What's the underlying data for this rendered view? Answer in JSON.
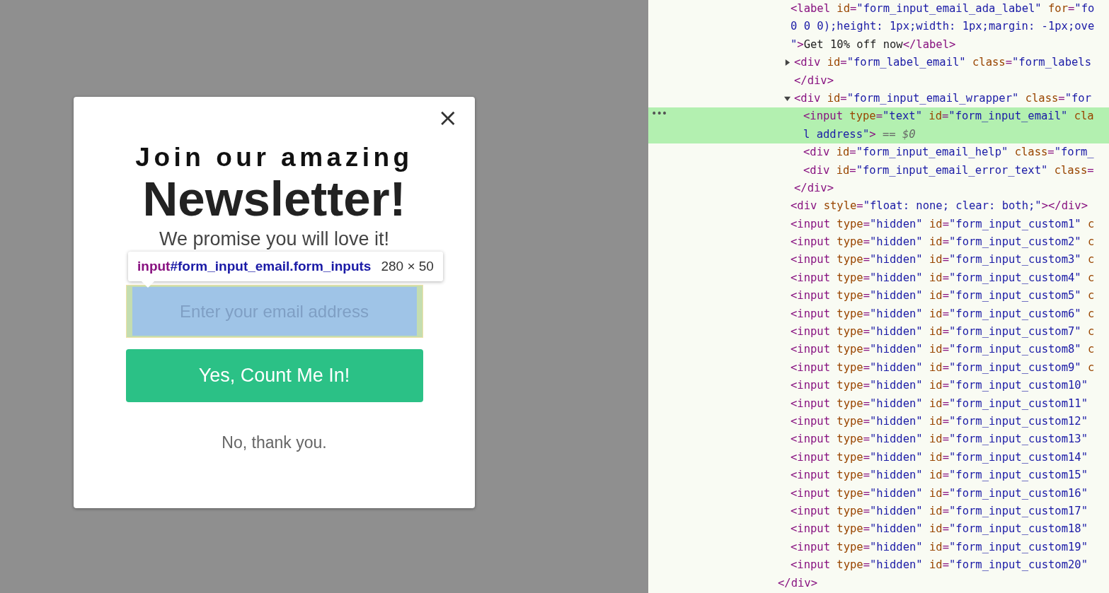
{
  "popup": {
    "close_label": "×",
    "title_line1": "Join our amazing",
    "title_line2": "Newsletter!",
    "subtitle": "We promise you will love it!",
    "email_field": {
      "placeholder": "Enter your email address",
      "inspected": true
    },
    "submit_button": "Yes, Count Me In!",
    "decline_link": "No, thank you."
  },
  "inspector_tooltip": {
    "tag": "input",
    "selector": "#form_input_email.form_inputs",
    "size": "280 × 50"
  },
  "elements_tree": {
    "row_menu": "•••",
    "closing": [
      {
        "kind": "tag",
        "text": "</div>"
      }
    ],
    "children": [
      {
        "selected": false,
        "lines": [
          [
            {
              "kind": "tag",
              "text": "<label"
            },
            {
              "kind": "attr",
              "text": " id"
            },
            {
              "kind": "tag",
              "text": "="
            },
            {
              "kind": "val",
              "text": "\"form_input_email_ada_label\""
            },
            {
              "kind": "attr",
              "text": " for"
            },
            {
              "kind": "tag",
              "text": "="
            },
            {
              "kind": "val",
              "text": "\"fo"
            }
          ],
          [
            {
              "kind": "val",
              "text": "0 0 0);height: 1px;width: 1px;margin: -1px;ove"
            }
          ],
          [
            {
              "kind": "val",
              "text": "\""
            },
            {
              "kind": "tag",
              "text": ">"
            },
            {
              "kind": "text",
              "text": "Get 10% off now"
            },
            {
              "kind": "tag",
              "text": "</label>"
            }
          ]
        ]
      },
      {
        "selected": false,
        "expanded": false,
        "lines": [
          [
            {
              "kind": "tag",
              "text": "<div"
            },
            {
              "kind": "attr",
              "text": " id"
            },
            {
              "kind": "tag",
              "text": "="
            },
            {
              "kind": "val",
              "text": "\"form_label_email\""
            },
            {
              "kind": "attr",
              "text": " class"
            },
            {
              "kind": "tag",
              "text": "="
            },
            {
              "kind": "val",
              "text": "\"form_labels"
            }
          ]
        ],
        "closing": [
          {
            "kind": "tag",
            "text": "</div>"
          }
        ]
      },
      {
        "selected": false,
        "expanded": true,
        "lines": [
          [
            {
              "kind": "tag",
              "text": "<div"
            },
            {
              "kind": "attr",
              "text": " id"
            },
            {
              "kind": "tag",
              "text": "="
            },
            {
              "kind": "val",
              "text": "\"form_input_email_wrapper\""
            },
            {
              "kind": "attr",
              "text": " class"
            },
            {
              "kind": "tag",
              "text": "="
            },
            {
              "kind": "val",
              "text": "\"for"
            }
          ]
        ],
        "closing": [
          {
            "kind": "tag",
            "text": "</div>"
          }
        ],
        "children": [
          {
            "selected": true,
            "lines": [
              [
                {
                  "kind": "tag",
                  "text": "<input"
                },
                {
                  "kind": "attr",
                  "text": " type"
                },
                {
                  "kind": "tag",
                  "text": "="
                },
                {
                  "kind": "val",
                  "text": "\"text\""
                },
                {
                  "kind": "attr",
                  "text": " id"
                },
                {
                  "kind": "tag",
                  "text": "="
                },
                {
                  "kind": "val",
                  "text": "\"form_input_email\""
                },
                {
                  "kind": "attr",
                  "text": " cla"
                }
              ],
              [
                {
                  "kind": "val",
                  "text": "l address\""
                },
                {
                  "kind": "tag",
                  "text": ">"
                },
                {
                  "kind": "dim",
                  "text": " == $0"
                }
              ]
            ]
          },
          {
            "selected": false,
            "lines": [
              [
                {
                  "kind": "tag",
                  "text": "<div"
                },
                {
                  "kind": "attr",
                  "text": " id"
                },
                {
                  "kind": "tag",
                  "text": "="
                },
                {
                  "kind": "val",
                  "text": "\"form_input_email_help\""
                },
                {
                  "kind": "attr",
                  "text": " class"
                },
                {
                  "kind": "tag",
                  "text": "="
                },
                {
                  "kind": "val",
                  "text": "\"form_"
                }
              ]
            ]
          },
          {
            "selected": false,
            "lines": [
              [
                {
                  "kind": "tag",
                  "text": "<div"
                },
                {
                  "kind": "attr",
                  "text": " id"
                },
                {
                  "kind": "tag",
                  "text": "="
                },
                {
                  "kind": "val",
                  "text": "\"form_input_email_error_text\""
                },
                {
                  "kind": "attr",
                  "text": " class"
                },
                {
                  "kind": "tag",
                  "text": "="
                }
              ]
            ]
          }
        ]
      },
      {
        "selected": false,
        "lines": [
          [
            {
              "kind": "tag",
              "text": "<div"
            },
            {
              "kind": "attr",
              "text": " style"
            },
            {
              "kind": "tag",
              "text": "="
            },
            {
              "kind": "val",
              "text": "\"float: none; clear: both;\""
            },
            {
              "kind": "tag",
              "text": "></div>"
            }
          ]
        ]
      },
      {
        "selected": false,
        "lines": [
          [
            {
              "kind": "tag",
              "text": "<input"
            },
            {
              "kind": "attr",
              "text": " type"
            },
            {
              "kind": "tag",
              "text": "="
            },
            {
              "kind": "val",
              "text": "\"hidden\""
            },
            {
              "kind": "attr",
              "text": " id"
            },
            {
              "kind": "tag",
              "text": "="
            },
            {
              "kind": "val",
              "text": "\"form_input_custom1\""
            },
            {
              "kind": "attr",
              "text": " c"
            }
          ]
        ]
      },
      {
        "selected": false,
        "lines": [
          [
            {
              "kind": "tag",
              "text": "<input"
            },
            {
              "kind": "attr",
              "text": " type"
            },
            {
              "kind": "tag",
              "text": "="
            },
            {
              "kind": "val",
              "text": "\"hidden\""
            },
            {
              "kind": "attr",
              "text": " id"
            },
            {
              "kind": "tag",
              "text": "="
            },
            {
              "kind": "val",
              "text": "\"form_input_custom2\""
            },
            {
              "kind": "attr",
              "text": " c"
            }
          ]
        ]
      },
      {
        "selected": false,
        "lines": [
          [
            {
              "kind": "tag",
              "text": "<input"
            },
            {
              "kind": "attr",
              "text": " type"
            },
            {
              "kind": "tag",
              "text": "="
            },
            {
              "kind": "val",
              "text": "\"hidden\""
            },
            {
              "kind": "attr",
              "text": " id"
            },
            {
              "kind": "tag",
              "text": "="
            },
            {
              "kind": "val",
              "text": "\"form_input_custom3\""
            },
            {
              "kind": "attr",
              "text": " c"
            }
          ]
        ]
      },
      {
        "selected": false,
        "lines": [
          [
            {
              "kind": "tag",
              "text": "<input"
            },
            {
              "kind": "attr",
              "text": " type"
            },
            {
              "kind": "tag",
              "text": "="
            },
            {
              "kind": "val",
              "text": "\"hidden\""
            },
            {
              "kind": "attr",
              "text": " id"
            },
            {
              "kind": "tag",
              "text": "="
            },
            {
              "kind": "val",
              "text": "\"form_input_custom4\""
            },
            {
              "kind": "attr",
              "text": " c"
            }
          ]
        ]
      },
      {
        "selected": false,
        "lines": [
          [
            {
              "kind": "tag",
              "text": "<input"
            },
            {
              "kind": "attr",
              "text": " type"
            },
            {
              "kind": "tag",
              "text": "="
            },
            {
              "kind": "val",
              "text": "\"hidden\""
            },
            {
              "kind": "attr",
              "text": " id"
            },
            {
              "kind": "tag",
              "text": "="
            },
            {
              "kind": "val",
              "text": "\"form_input_custom5\""
            },
            {
              "kind": "attr",
              "text": " c"
            }
          ]
        ]
      },
      {
        "selected": false,
        "lines": [
          [
            {
              "kind": "tag",
              "text": "<input"
            },
            {
              "kind": "attr",
              "text": " type"
            },
            {
              "kind": "tag",
              "text": "="
            },
            {
              "kind": "val",
              "text": "\"hidden\""
            },
            {
              "kind": "attr",
              "text": " id"
            },
            {
              "kind": "tag",
              "text": "="
            },
            {
              "kind": "val",
              "text": "\"form_input_custom6\""
            },
            {
              "kind": "attr",
              "text": " c"
            }
          ]
        ]
      },
      {
        "selected": false,
        "lines": [
          [
            {
              "kind": "tag",
              "text": "<input"
            },
            {
              "kind": "attr",
              "text": " type"
            },
            {
              "kind": "tag",
              "text": "="
            },
            {
              "kind": "val",
              "text": "\"hidden\""
            },
            {
              "kind": "attr",
              "text": " id"
            },
            {
              "kind": "tag",
              "text": "="
            },
            {
              "kind": "val",
              "text": "\"form_input_custom7\""
            },
            {
              "kind": "attr",
              "text": " c"
            }
          ]
        ]
      },
      {
        "selected": false,
        "lines": [
          [
            {
              "kind": "tag",
              "text": "<input"
            },
            {
              "kind": "attr",
              "text": " type"
            },
            {
              "kind": "tag",
              "text": "="
            },
            {
              "kind": "val",
              "text": "\"hidden\""
            },
            {
              "kind": "attr",
              "text": " id"
            },
            {
              "kind": "tag",
              "text": "="
            },
            {
              "kind": "val",
              "text": "\"form_input_custom8\""
            },
            {
              "kind": "attr",
              "text": " c"
            }
          ]
        ]
      },
      {
        "selected": false,
        "lines": [
          [
            {
              "kind": "tag",
              "text": "<input"
            },
            {
              "kind": "attr",
              "text": " type"
            },
            {
              "kind": "tag",
              "text": "="
            },
            {
              "kind": "val",
              "text": "\"hidden\""
            },
            {
              "kind": "attr",
              "text": " id"
            },
            {
              "kind": "tag",
              "text": "="
            },
            {
              "kind": "val",
              "text": "\"form_input_custom9\""
            },
            {
              "kind": "attr",
              "text": " c"
            }
          ]
        ]
      },
      {
        "selected": false,
        "lines": [
          [
            {
              "kind": "tag",
              "text": "<input"
            },
            {
              "kind": "attr",
              "text": " type"
            },
            {
              "kind": "tag",
              "text": "="
            },
            {
              "kind": "val",
              "text": "\"hidden\""
            },
            {
              "kind": "attr",
              "text": " id"
            },
            {
              "kind": "tag",
              "text": "="
            },
            {
              "kind": "val",
              "text": "\"form_input_custom10\""
            }
          ]
        ]
      },
      {
        "selected": false,
        "lines": [
          [
            {
              "kind": "tag",
              "text": "<input"
            },
            {
              "kind": "attr",
              "text": " type"
            },
            {
              "kind": "tag",
              "text": "="
            },
            {
              "kind": "val",
              "text": "\"hidden\""
            },
            {
              "kind": "attr",
              "text": " id"
            },
            {
              "kind": "tag",
              "text": "="
            },
            {
              "kind": "val",
              "text": "\"form_input_custom11\""
            }
          ]
        ]
      },
      {
        "selected": false,
        "lines": [
          [
            {
              "kind": "tag",
              "text": "<input"
            },
            {
              "kind": "attr",
              "text": " type"
            },
            {
              "kind": "tag",
              "text": "="
            },
            {
              "kind": "val",
              "text": "\"hidden\""
            },
            {
              "kind": "attr",
              "text": " id"
            },
            {
              "kind": "tag",
              "text": "="
            },
            {
              "kind": "val",
              "text": "\"form_input_custom12\""
            }
          ]
        ]
      },
      {
        "selected": false,
        "lines": [
          [
            {
              "kind": "tag",
              "text": "<input"
            },
            {
              "kind": "attr",
              "text": " type"
            },
            {
              "kind": "tag",
              "text": "="
            },
            {
              "kind": "val",
              "text": "\"hidden\""
            },
            {
              "kind": "attr",
              "text": " id"
            },
            {
              "kind": "tag",
              "text": "="
            },
            {
              "kind": "val",
              "text": "\"form_input_custom13\""
            }
          ]
        ]
      },
      {
        "selected": false,
        "lines": [
          [
            {
              "kind": "tag",
              "text": "<input"
            },
            {
              "kind": "attr",
              "text": " type"
            },
            {
              "kind": "tag",
              "text": "="
            },
            {
              "kind": "val",
              "text": "\"hidden\""
            },
            {
              "kind": "attr",
              "text": " id"
            },
            {
              "kind": "tag",
              "text": "="
            },
            {
              "kind": "val",
              "text": "\"form_input_custom14\""
            }
          ]
        ]
      },
      {
        "selected": false,
        "lines": [
          [
            {
              "kind": "tag",
              "text": "<input"
            },
            {
              "kind": "attr",
              "text": " type"
            },
            {
              "kind": "tag",
              "text": "="
            },
            {
              "kind": "val",
              "text": "\"hidden\""
            },
            {
              "kind": "attr",
              "text": " id"
            },
            {
              "kind": "tag",
              "text": "="
            },
            {
              "kind": "val",
              "text": "\"form_input_custom15\""
            }
          ]
        ]
      },
      {
        "selected": false,
        "lines": [
          [
            {
              "kind": "tag",
              "text": "<input"
            },
            {
              "kind": "attr",
              "text": " type"
            },
            {
              "kind": "tag",
              "text": "="
            },
            {
              "kind": "val",
              "text": "\"hidden\""
            },
            {
              "kind": "attr",
              "text": " id"
            },
            {
              "kind": "tag",
              "text": "="
            },
            {
              "kind": "val",
              "text": "\"form_input_custom16\""
            }
          ]
        ]
      },
      {
        "selected": false,
        "lines": [
          [
            {
              "kind": "tag",
              "text": "<input"
            },
            {
              "kind": "attr",
              "text": " type"
            },
            {
              "kind": "tag",
              "text": "="
            },
            {
              "kind": "val",
              "text": "\"hidden\""
            },
            {
              "kind": "attr",
              "text": " id"
            },
            {
              "kind": "tag",
              "text": "="
            },
            {
              "kind": "val",
              "text": "\"form_input_custom17\""
            }
          ]
        ]
      },
      {
        "selected": false,
        "lines": [
          [
            {
              "kind": "tag",
              "text": "<input"
            },
            {
              "kind": "attr",
              "text": " type"
            },
            {
              "kind": "tag",
              "text": "="
            },
            {
              "kind": "val",
              "text": "\"hidden\""
            },
            {
              "kind": "attr",
              "text": " id"
            },
            {
              "kind": "tag",
              "text": "="
            },
            {
              "kind": "val",
              "text": "\"form_input_custom18\""
            }
          ]
        ]
      },
      {
        "selected": false,
        "lines": [
          [
            {
              "kind": "tag",
              "text": "<input"
            },
            {
              "kind": "attr",
              "text": " type"
            },
            {
              "kind": "tag",
              "text": "="
            },
            {
              "kind": "val",
              "text": "\"hidden\""
            },
            {
              "kind": "attr",
              "text": " id"
            },
            {
              "kind": "tag",
              "text": "="
            },
            {
              "kind": "val",
              "text": "\"form_input_custom19\""
            }
          ]
        ]
      },
      {
        "selected": false,
        "lines": [
          [
            {
              "kind": "tag",
              "text": "<input"
            },
            {
              "kind": "attr",
              "text": " type"
            },
            {
              "kind": "tag",
              "text": "="
            },
            {
              "kind": "val",
              "text": "\"hidden\""
            },
            {
              "kind": "attr",
              "text": " id"
            },
            {
              "kind": "tag",
              "text": "="
            },
            {
              "kind": "val",
              "text": "\"form_input_custom20\""
            }
          ]
        ]
      }
    ]
  }
}
